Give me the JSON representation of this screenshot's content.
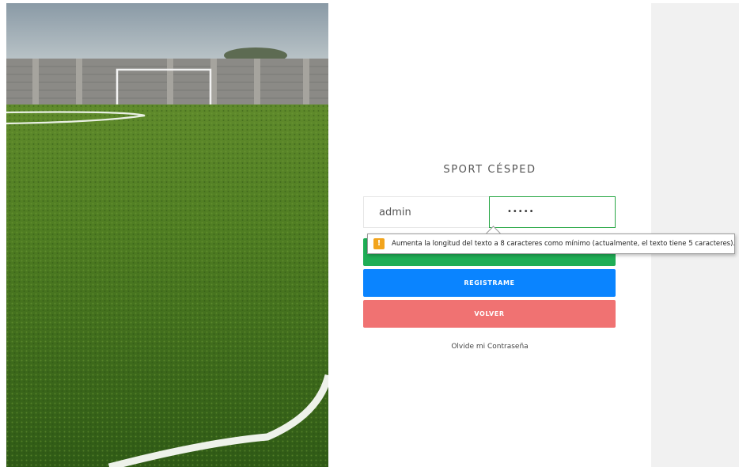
{
  "brand": "SPORT CÉSPED",
  "login": {
    "username_value": "admin",
    "password_value": "•••••"
  },
  "buttons": {
    "register": "REGISTRAME",
    "back": "VOLVER"
  },
  "forgot_link": "Olvide mi Contraseña",
  "validation_tooltip": {
    "icon": "warning-icon",
    "text": "Aumenta la longitud del texto a 8 caracteres como mínimo (actualmente, el texto tiene 5 caracteres)."
  },
  "colors": {
    "login_button": "#1fae56",
    "register_button": "#0a84ff",
    "back_button": "#f07272",
    "warning": "#f2a41c",
    "password_focus_border": "#28a745"
  }
}
